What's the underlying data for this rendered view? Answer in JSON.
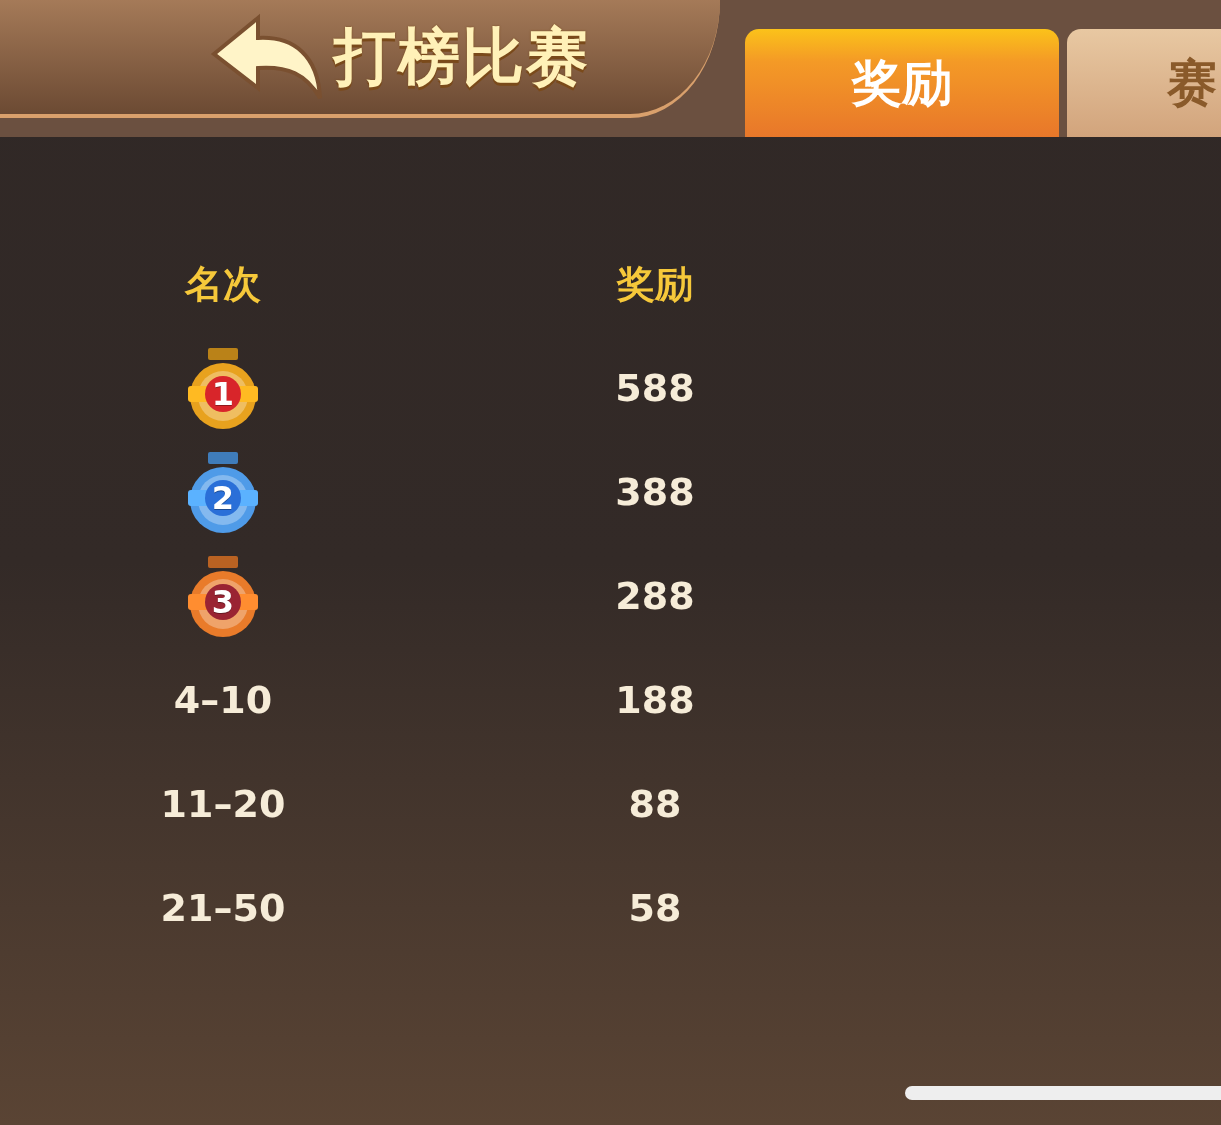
{
  "header": {
    "title": "打榜比赛"
  },
  "tabs": [
    {
      "label": "奖励",
      "selected": true
    },
    {
      "label": "赛",
      "selected": false
    }
  ],
  "table": {
    "columns": [
      "名次",
      "奖励"
    ],
    "rows": [
      {
        "kind": "medal",
        "rank": "1",
        "color": "#e8a21e",
        "reward": "588"
      },
      {
        "kind": "medal",
        "rank": "2",
        "color": "#4f9be8",
        "reward": "388"
      },
      {
        "kind": "medal",
        "rank": "3",
        "color": "#e97b2a",
        "reward": "288"
      },
      {
        "kind": "text",
        "rank": "4–10",
        "reward": "188"
      },
      {
        "kind": "text",
        "rank": "11–20",
        "reward": "88"
      },
      {
        "kind": "text",
        "rank": "21–50",
        "reward": "58"
      }
    ]
  }
}
